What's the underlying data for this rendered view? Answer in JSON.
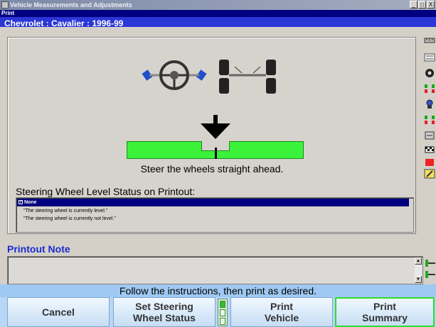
{
  "window": {
    "title": "Vehicle Measurements and Adjustments",
    "buttons": [
      "_",
      "□",
      "X"
    ]
  },
  "print_label": "Print",
  "vehicle_title": "Chevrolet : Cavalier : 1996-99",
  "instruction": "Steer the wheels straight ahead.",
  "status": {
    "label": "Steering Wheel Level Status on Printout:",
    "options": [
      {
        "text": "None",
        "selected": true
      },
      {
        "text": "\"The steering wheel is currently level.\"",
        "selected": false
      },
      {
        "text": "\"The steering wheel is currently not level.\"",
        "selected": false
      }
    ]
  },
  "note": {
    "heading": "Printout Note",
    "value": ""
  },
  "footer_message": "Follow the instructions, then print as desired.",
  "softkeys": {
    "cancel": "Cancel",
    "set_steering": "Set Steering\nWheel Status",
    "print_vehicle": "Print\nVehicle",
    "print_summary": "Print\nSummary"
  },
  "colors": {
    "accent_blue": "#2a36d6",
    "meter_green": "#3bf23b",
    "footer_blue": "#9fc9f2",
    "highlight_green": "#2fdc2f"
  },
  "toolbar_icons": [
    "ruler-icon",
    "readout-icon",
    "wheel-icon",
    "axle-icon",
    "gauge-icon",
    "axle-icon",
    "tool-icon",
    "flag-icon",
    "ruler-icon",
    "wrench-icon"
  ]
}
